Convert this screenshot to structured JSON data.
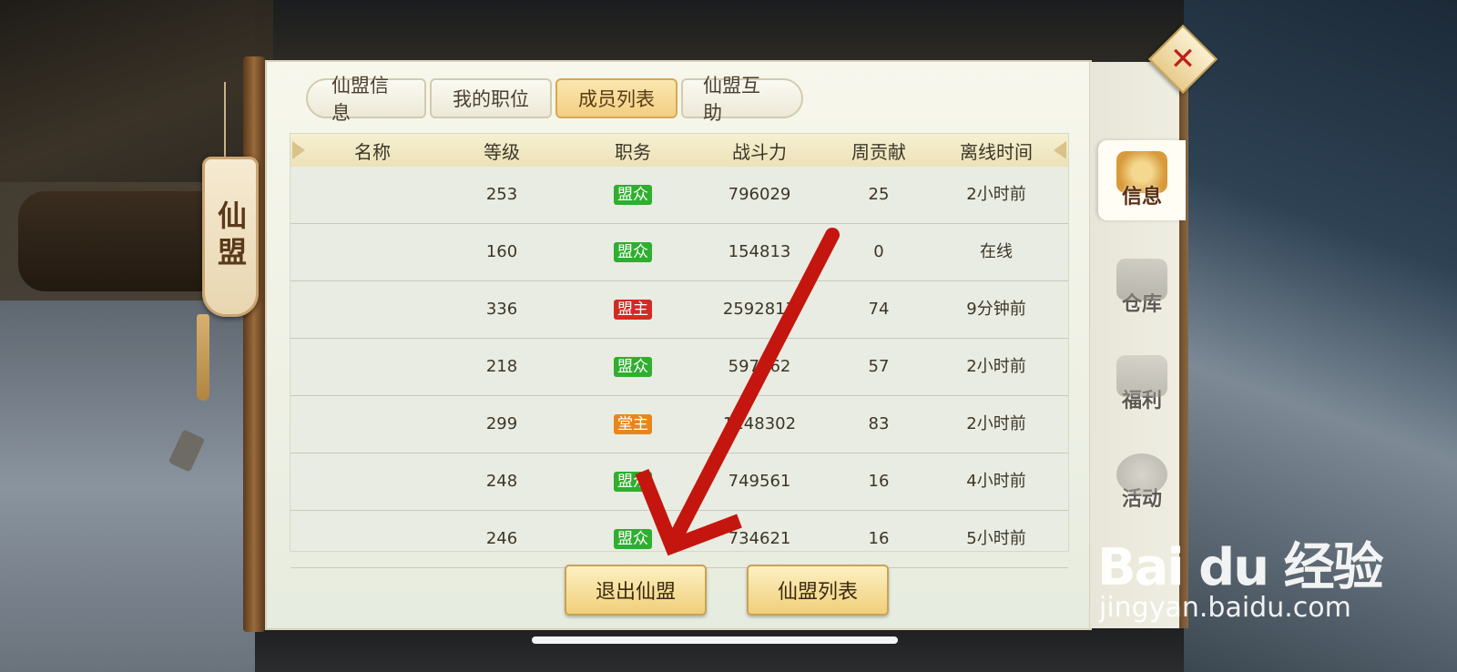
{
  "sidebar_tag": "仙盟",
  "tabs": [
    {
      "label": "仙盟信息",
      "active": false
    },
    {
      "label": "我的职位",
      "active": false
    },
    {
      "label": "成员列表",
      "active": true
    },
    {
      "label": "仙盟互助",
      "active": false
    }
  ],
  "table": {
    "headers": [
      "名称",
      "等级",
      "职务",
      "战斗力",
      "周贡献",
      "离线时间"
    ],
    "rows": [
      {
        "name": "",
        "level": "253",
        "role": "盟众",
        "role_color": "#2fae2f",
        "power": "796029",
        "weekly": "25",
        "offline": "2小时前"
      },
      {
        "name": "",
        "level": "160",
        "role": "盟众",
        "role_color": "#2fae2f",
        "power": "154813",
        "weekly": "0",
        "offline": "在线"
      },
      {
        "name": "",
        "level": "336",
        "role": "盟主",
        "role_color": "#d22a24",
        "power": "2592817",
        "weekly": "74",
        "offline": "9分钟前"
      },
      {
        "name": "",
        "level": "218",
        "role": "盟众",
        "role_color": "#2fae2f",
        "power": "597062",
        "weekly": "57",
        "offline": "2小时前"
      },
      {
        "name": "",
        "level": "299",
        "role": "堂主",
        "role_color": "#e8861c",
        "power": "1148302",
        "weekly": "83",
        "offline": "2小时前"
      },
      {
        "name": "",
        "level": "248",
        "role": "盟众",
        "role_color": "#2fae2f",
        "power": "749561",
        "weekly": "16",
        "offline": "4小时前"
      },
      {
        "name": "",
        "level": "246",
        "role": "盟众",
        "role_color": "#2fae2f",
        "power": "734621",
        "weekly": "16",
        "offline": "5小时前"
      }
    ]
  },
  "buttons": {
    "quit": "退出仙盟",
    "list": "仙盟列表"
  },
  "side_nav": [
    {
      "label": "信息",
      "icon": "scroll-icon",
      "active": true
    },
    {
      "label": "仓库",
      "icon": "warehouse-icon",
      "active": false
    },
    {
      "label": "福利",
      "icon": "gift-icon",
      "active": false
    },
    {
      "label": "活动",
      "icon": "lantern-icon",
      "active": false
    }
  ],
  "close_icon": "close-icon",
  "watermark": {
    "logo": "Bai du 经验",
    "url": "jingyan.baidu.com"
  }
}
